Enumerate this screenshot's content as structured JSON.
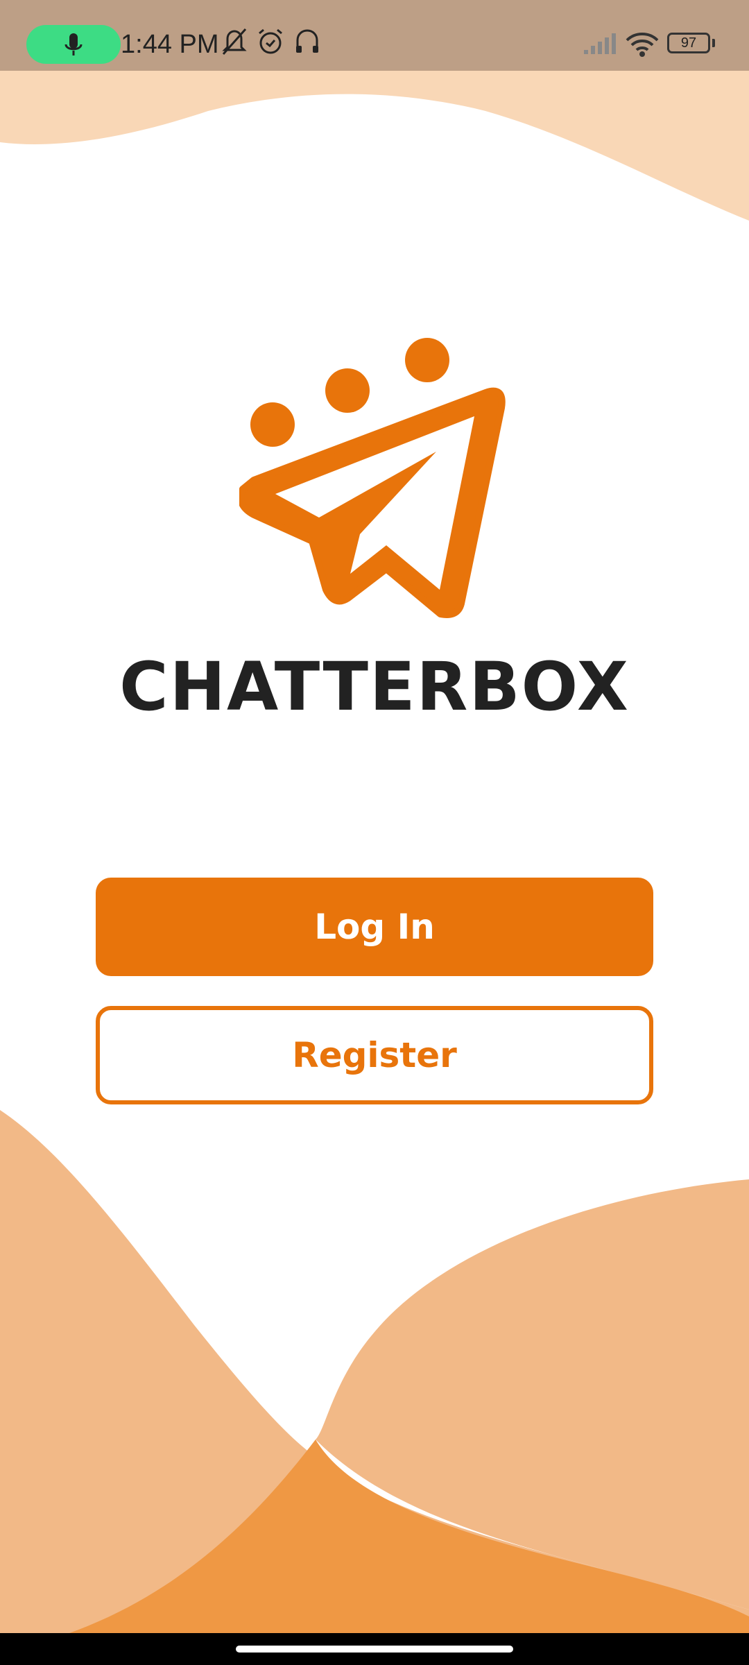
{
  "status_bar": {
    "time": "1:44 PM",
    "battery": "97",
    "icons": [
      "mic-icon",
      "bell-off-icon",
      "alarm-icon",
      "headset-icon",
      "signal-icon",
      "wifi-icon",
      "battery-icon"
    ]
  },
  "app": {
    "brand_name": "CHATTERBOX"
  },
  "buttons": {
    "login_label": "Log In",
    "register_label": "Register"
  },
  "colors": {
    "accent": "#e8740b",
    "status_bar": "#bd9f86",
    "wave_light": "#f9d7b6",
    "wave_mid": "#f2b987",
    "wave_dark": "#ef9844",
    "text_dark": "#222222",
    "mic_pill": "#3ddc84"
  }
}
